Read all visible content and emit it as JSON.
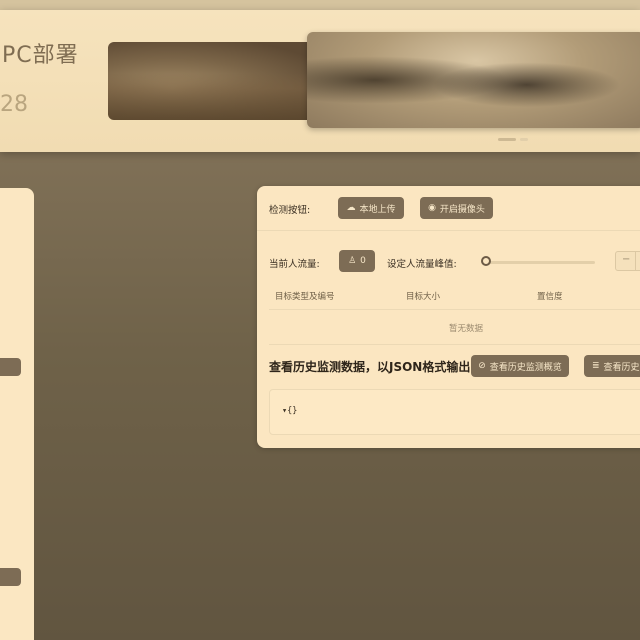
{
  "header": {
    "title": "PC部署",
    "subtitle": "28"
  },
  "detect": {
    "label": "检测按钮:",
    "upload_label": "本地上传",
    "upload_icon": "cloud-upload-icon",
    "camera_label": "开启摄像头",
    "camera_icon": "eye-icon"
  },
  "flow": {
    "current_label": "当前人流量:",
    "current_value": "0",
    "current_icon": "user-icon",
    "threshold_label": "设定人流量峰值:",
    "threshold_slider_value": 0,
    "stepper_minus": "−"
  },
  "table": {
    "columns": [
      "目标类型及编号",
      "目标大小",
      "置信度"
    ],
    "empty_text": "暂无数据"
  },
  "history": {
    "title": "查看历史监测数据，以JSON格式输出",
    "overview_label": "查看历史监测概览",
    "overview_icon": "link-icon",
    "history_label": "查看历史",
    "history_icon": "database-icon",
    "json_text": "▾{}"
  },
  "colors": {
    "button_bg": "#7d6c55",
    "card_bg": "#fbe6c1",
    "page_bg": "#6f6249"
  }
}
